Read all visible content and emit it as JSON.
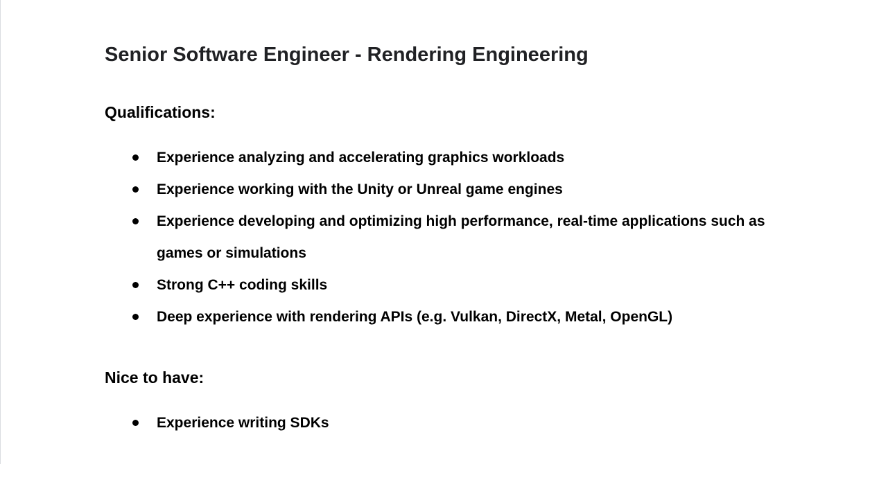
{
  "document": {
    "title": "Senior Software Engineer - Rendering Engineering",
    "qualifications": {
      "heading": "Qualifications:",
      "items": [
        "Experience analyzing and accelerating graphics workloads",
        "Experience working with the Unity or Unreal game engines",
        "Experience developing and optimizing high performance, real-time applications such as games or simulations",
        "Strong C++ coding skills",
        "Deep experience with rendering APIs (e.g. Vulkan, DirectX, Metal, OpenGL)"
      ]
    },
    "nice_to_have": {
      "heading": "Nice to have:",
      "items": [
        "Experience writing SDKs"
      ]
    }
  }
}
